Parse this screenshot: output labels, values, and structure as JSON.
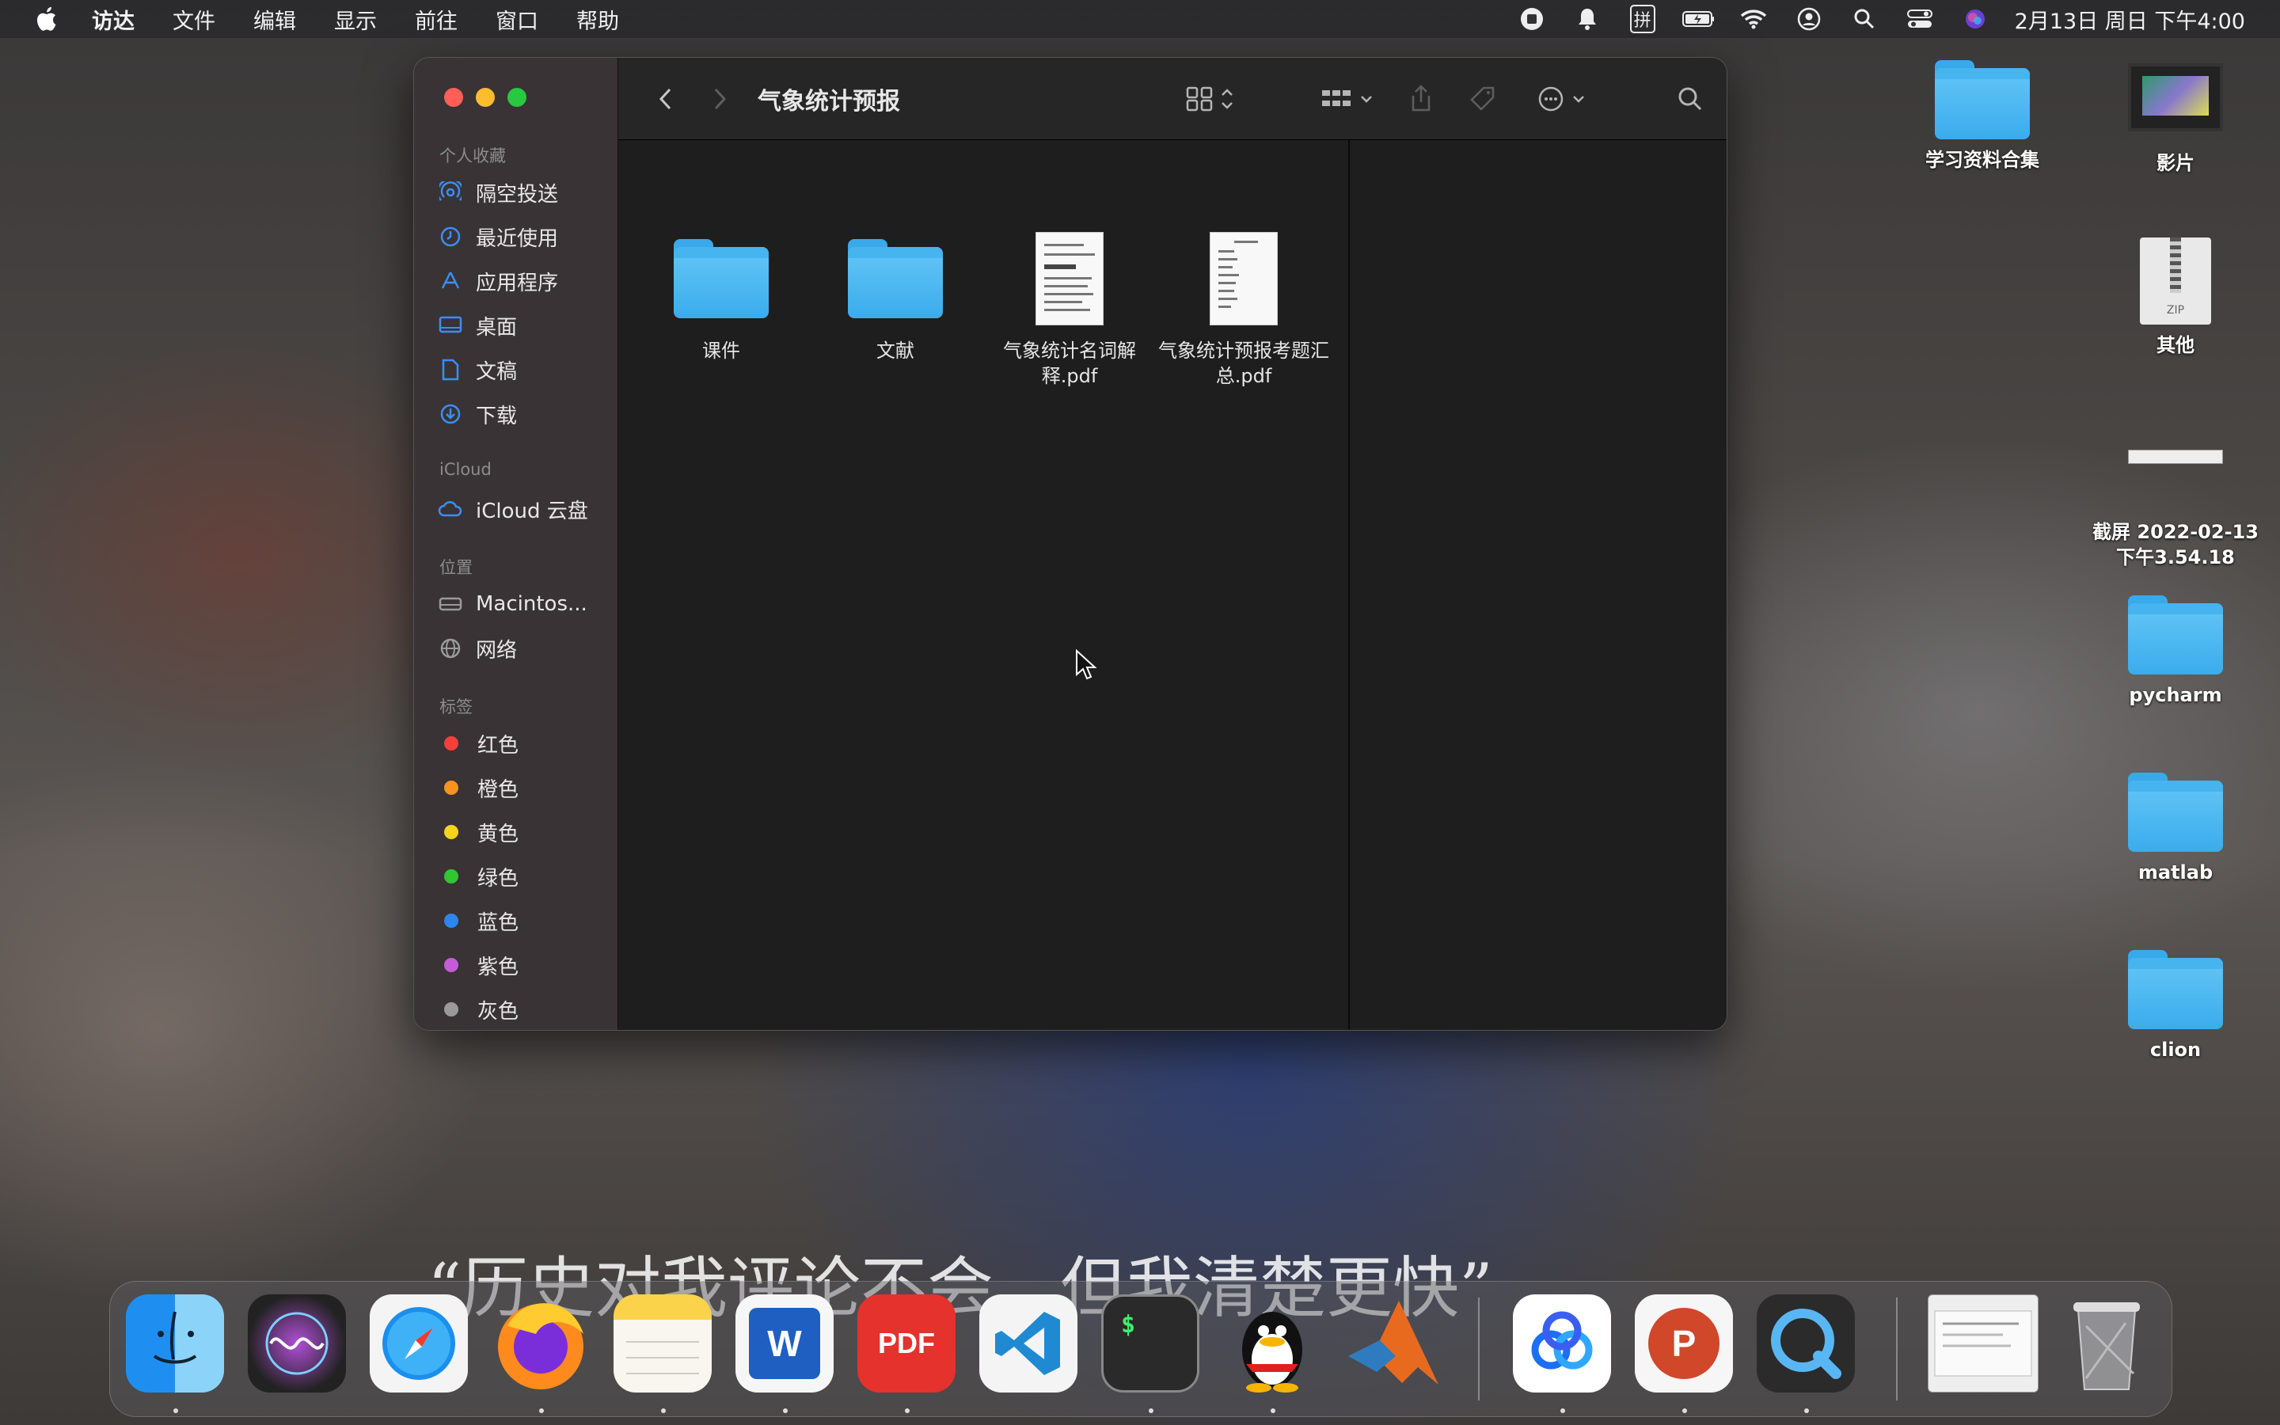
{
  "menubar": {
    "apple_icon": "apple-icon",
    "items": [
      "访达",
      "文件",
      "编辑",
      "显示",
      "前往",
      "窗口",
      "帮助"
    ],
    "clock": "2月13日 周日 下午4:00",
    "status_input_method": "拼"
  },
  "desktop": {
    "items": [
      {
        "label": "学习资料合集",
        "kind": "folder"
      },
      {
        "label": "影片",
        "kind": "movie"
      },
      {
        "label": "其他",
        "kind": "zip"
      },
      {
        "label": "截屏 2022-02-13 下午3.54.18",
        "kind": "screenshot"
      },
      {
        "label": "pycharm",
        "kind": "folder"
      },
      {
        "label": "matlab",
        "kind": "folder"
      },
      {
        "label": "clion",
        "kind": "folder"
      }
    ],
    "zip_text": "ZIP"
  },
  "finder": {
    "title": "气象统计预报",
    "sidebar": {
      "favorites_header": "个人收藏",
      "favorites": [
        {
          "label": "隔空投送",
          "icon": "airdrop-icon"
        },
        {
          "label": "最近使用",
          "icon": "clock-icon"
        },
        {
          "label": "应用程序",
          "icon": "apps-icon"
        },
        {
          "label": "桌面",
          "icon": "desktop-icon"
        },
        {
          "label": "文稿",
          "icon": "document-icon"
        },
        {
          "label": "下载",
          "icon": "download-icon"
        }
      ],
      "icloud_header": "iCloud",
      "icloud": [
        {
          "label": "iCloud 云盘",
          "icon": "cloud-icon"
        }
      ],
      "locations_header": "位置",
      "locations": [
        {
          "label": "Macintos...",
          "icon": "disk-icon"
        },
        {
          "label": "网络",
          "icon": "globe-icon"
        }
      ],
      "tags_header": "标签",
      "tags": [
        {
          "label": "红色",
          "color": "#f4403a"
        },
        {
          "label": "橙色",
          "color": "#f7941d"
        },
        {
          "label": "黄色",
          "color": "#f7d31d"
        },
        {
          "label": "绿色",
          "color": "#31c731"
        },
        {
          "label": "蓝色",
          "color": "#2d86f0"
        },
        {
          "label": "紫色",
          "color": "#c45cd8"
        },
        {
          "label": "灰色",
          "color": "#9a9a9a"
        }
      ]
    },
    "files": [
      {
        "label": "课件",
        "kind": "folder"
      },
      {
        "label": "文献",
        "kind": "folder"
      },
      {
        "label": "气象统计名词解释.pdf",
        "kind": "pdf"
      },
      {
        "label": "气象统计预报考题汇总.pdf",
        "kind": "pdf"
      }
    ]
  },
  "dock": {
    "apps": [
      "Finder",
      "Siri",
      "Safari",
      "Firefox",
      "Notes",
      "Word",
      "PDF Expert",
      "VS Code",
      "Terminal",
      "QQ",
      "MATLAB",
      "Baidu Netdisk",
      "PowerPoint",
      "QuickTime"
    ],
    "pdf_badge": "PDF",
    "word_letter": "W",
    "ppt_letter": "P",
    "terminal_text": "$"
  },
  "wallpaper_caption": "“历史对我评论不会，但我清楚更快”",
  "colors": {
    "accent": "#3a8ef6",
    "folder_blue": "#4ab6f0",
    "close": "#ff5f57",
    "minimize": "#febc2e",
    "zoom": "#28c840"
  }
}
